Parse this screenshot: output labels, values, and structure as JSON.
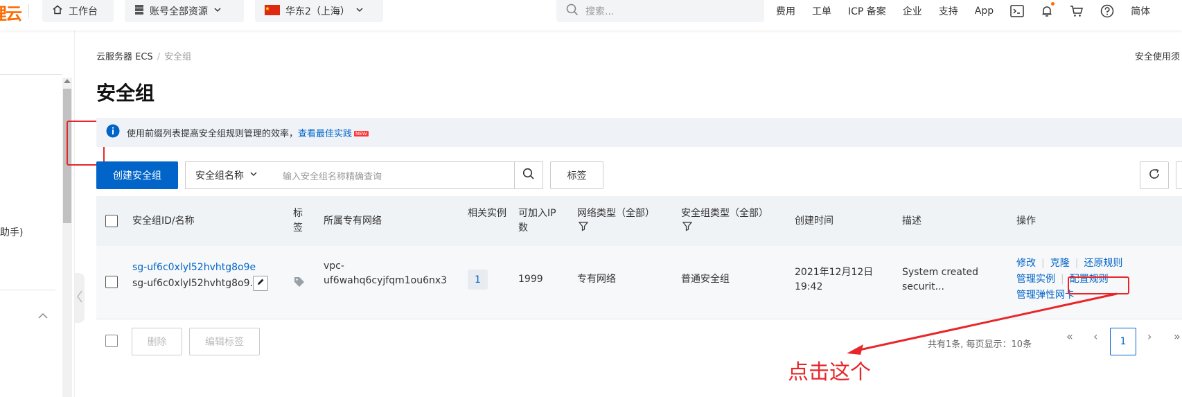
{
  "topbar": {
    "logo_text": "狸云",
    "workbench_label": "工作台",
    "resources_label": "账号全部资源",
    "region_label": "华东2（上海）",
    "search_placeholder": "搜索...",
    "nav_items": [
      "费用",
      "工单",
      "ICP 备案",
      "企业",
      "支持",
      "App"
    ],
    "lang_label": "简体",
    "accent_color": "#ff6a00"
  },
  "sidebar": {
    "partial_text": "助手)"
  },
  "breadcrumb": {
    "items": [
      "云服务器 ECS",
      "安全组"
    ]
  },
  "top_right_link": "安全使用须",
  "page_title": "安全组",
  "notice": {
    "text": "使用前缀列表提高安全组规则管理的效率，",
    "link": "查看最佳实践",
    "new_tag": "NEW"
  },
  "toolbar": {
    "create_button": "创建安全组",
    "filter_select": "安全组名称",
    "search_placeholder": "输入安全组名称精确查询",
    "tag_button": "标签"
  },
  "table": {
    "headers": {
      "id_name": "安全组ID/名称",
      "tag": "标签",
      "vpc": "所属专有网络",
      "instances": "相关实例",
      "ip_capacity": "可加入IP数",
      "network_type": "网络类型（全部）",
      "group_type": "安全组类型（全部）",
      "created": "创建时间",
      "desc": "描述",
      "actions": "操作"
    },
    "rows": [
      {
        "id": "sg-uf6c0xlyl52hvhtg8o9e",
        "name": "sg-uf6c0xlyl52hvhtg8o9...",
        "vpc_line1": "vpc-",
        "vpc_line2": "uf6wahq6cyjfqm1ou6nx3",
        "instances": "1",
        "ip_capacity": "1999",
        "network_type": "专有网络",
        "group_type": "普通安全组",
        "created_date": "2021年12月12日",
        "created_time": "19:42",
        "desc_line1": "System created",
        "desc_line2": "securit...",
        "actions": {
          "modify": "修改",
          "clone": "克隆",
          "restore": "还原规则",
          "manage_instances": "管理实例",
          "config_rules": "配置规则",
          "manage_eni": "管理弹性网卡"
        }
      }
    ]
  },
  "footer": {
    "delete_button": "删除",
    "edit_tags_button": "编辑标签",
    "pager_text": "共有1条, 每页显示：10条",
    "current_page": "1"
  },
  "annotation": {
    "text": "点击这个",
    "color": "#e8262a"
  }
}
